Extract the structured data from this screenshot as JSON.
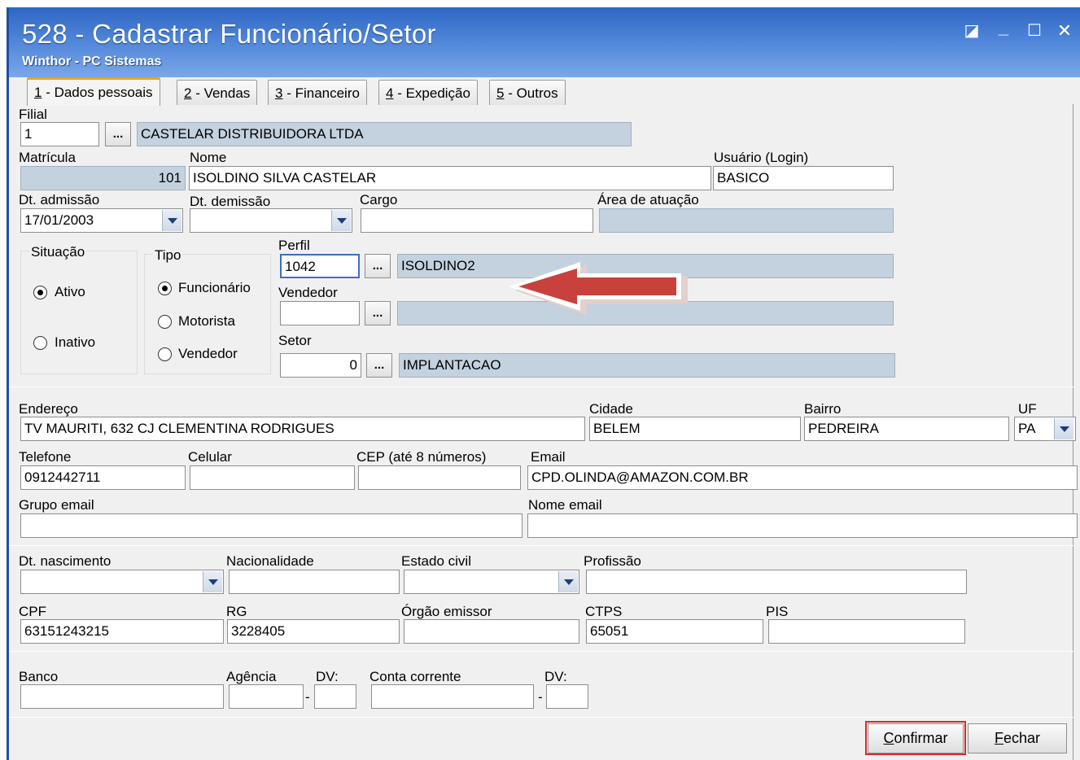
{
  "window": {
    "title": "528 - Cadastrar Funcionário/Setor",
    "subtitle": "Winthor - PC Sistemas",
    "controls": {
      "restore": "◪",
      "minimize": "_",
      "maximize": "☐",
      "close": "✕"
    }
  },
  "tabs": [
    {
      "key": "1",
      "label": " - Dados pessoais"
    },
    {
      "key": "2",
      "label": " - Vendas"
    },
    {
      "key": "3",
      "label": " - Financeiro"
    },
    {
      "key": "4",
      "label": " - Expedição"
    },
    {
      "key": "5",
      "label": " - Outros"
    }
  ],
  "form": {
    "filial": {
      "label": "Filial",
      "value": "1",
      "desc": "CASTELAR DISTRIBUIDORA LTDA"
    },
    "matricula": {
      "label": "Matrícula",
      "value": "101"
    },
    "nome": {
      "label": "Nome",
      "value": "ISOLDINO SILVA CASTELAR"
    },
    "usuario": {
      "label": "Usuário (Login)",
      "value": "BASICO"
    },
    "dt_admissao": {
      "label": "Dt. admissão",
      "value": "17/01/2003"
    },
    "dt_demissao": {
      "label": "Dt.  demissão",
      "value": ""
    },
    "cargo": {
      "label": "Cargo",
      "value": ""
    },
    "area_atuacao": {
      "label": "Área de atuação",
      "value": ""
    },
    "situacao": {
      "label": "Situação",
      "options": [
        "Ativo",
        "Inativo"
      ],
      "selected": "Ativo"
    },
    "tipo": {
      "label": "Tipo",
      "options": [
        "Funcionário",
        "Motorista",
        "Vendedor"
      ],
      "selected": "Funcionário"
    },
    "perfil": {
      "label": "Perfil",
      "value": "1042",
      "desc": "ISOLDINO2"
    },
    "vendedor": {
      "label": "Vendedor",
      "value": "",
      "desc": ""
    },
    "setor": {
      "label": "Setor",
      "value": "0",
      "desc": "IMPLANTACAO"
    },
    "endereco": {
      "label": "Endereço",
      "value": "TV MAURITI, 632 CJ CLEMENTINA RODRIGUES"
    },
    "cidade": {
      "label": "Cidade",
      "value": "BELEM"
    },
    "bairro": {
      "label": "Bairro",
      "value": "PEDREIRA"
    },
    "uf": {
      "label": "UF",
      "value": "PA"
    },
    "telefone": {
      "label": "Telefone",
      "value": "0912442711"
    },
    "celular": {
      "label": "Celular",
      "value": ""
    },
    "cep": {
      "label": "CEP (até 8 números)",
      "value": ""
    },
    "email": {
      "label": "Email",
      "value": "CPD.OLINDA@AMAZON.COM.BR"
    },
    "grupo_email": {
      "label": "Grupo email",
      "value": ""
    },
    "nome_email": {
      "label": "Nome email",
      "value": ""
    },
    "dt_nascimento": {
      "label": "Dt. nascimento",
      "value": ""
    },
    "nacionalidade": {
      "label": "Nacionalidade",
      "value": ""
    },
    "estado_civil": {
      "label": "Estado civil",
      "value": ""
    },
    "profissao": {
      "label": "Profissão",
      "value": ""
    },
    "cpf": {
      "label": "CPF",
      "value": "63151243215"
    },
    "rg": {
      "label": "RG",
      "value": "3228405"
    },
    "orgao_emissor": {
      "label": "Órgão emissor",
      "value": ""
    },
    "ctps": {
      "label": "CTPS",
      "value": "65051"
    },
    "pis": {
      "label": "PIS",
      "value": ""
    },
    "banco": {
      "label": "Banco",
      "value": ""
    },
    "agencia": {
      "label": "Agência",
      "value": ""
    },
    "agencia_dv": {
      "label": "DV:",
      "value": ""
    },
    "conta": {
      "label": "Conta corrente",
      "value": ""
    },
    "conta_dv": {
      "label": "DV:",
      "value": ""
    },
    "dash": "-",
    "ellipsis": "..."
  },
  "footer": {
    "confirmar": {
      "key": "C",
      "rest": "onfirmar"
    },
    "fechar": {
      "key": "F",
      "rest": "echar"
    }
  },
  "colors": {
    "readonly_bg": "#c4d1de",
    "highlight": "#d42a2a",
    "arrow": "#c9413c",
    "active_tab_accent": "#f5a400"
  }
}
